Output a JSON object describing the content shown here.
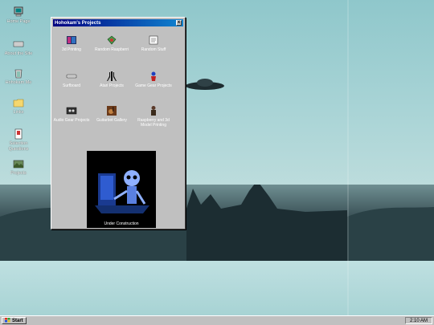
{
  "desktop": {
    "icons": [
      {
        "label": "Home Page",
        "icon": "computer-icon"
      },
      {
        "label": "About the Site",
        "icon": "keyboard-icon"
      },
      {
        "label": "Hohokam Me",
        "icon": "recycle-icon"
      },
      {
        "label": "Links",
        "icon": "folder-icon"
      },
      {
        "label": "Selection Questions",
        "icon": "document-icon"
      },
      {
        "label": "Projects",
        "icon": "photo-icon"
      }
    ]
  },
  "window": {
    "title": "Hohokam's Projects",
    "close_label": "x",
    "items": [
      {
        "label": "3d Printing",
        "icon": "3d-printing-icon"
      },
      {
        "label": "Random Raspberri",
        "icon": "raspberry-icon"
      },
      {
        "label": "Random Stuff",
        "icon": "notepad-icon"
      },
      {
        "label": "Surfboard",
        "icon": "surfboard-icon"
      },
      {
        "label": "Atari Projects",
        "icon": "atari-icon"
      },
      {
        "label": "Game Gear Projects",
        "icon": "gamegear-icon"
      },
      {
        "label": "Audio Gear Projects",
        "icon": "cassette-icon"
      },
      {
        "label": "Guitarbot Gallery",
        "icon": "guitar-icon"
      },
      {
        "label": "Raspberry and 3d Model Printing",
        "icon": "figure-icon"
      }
    ],
    "photo_caption": "Under Construction"
  },
  "taskbar": {
    "start_label": "Start",
    "clock": "2:10 AM"
  }
}
